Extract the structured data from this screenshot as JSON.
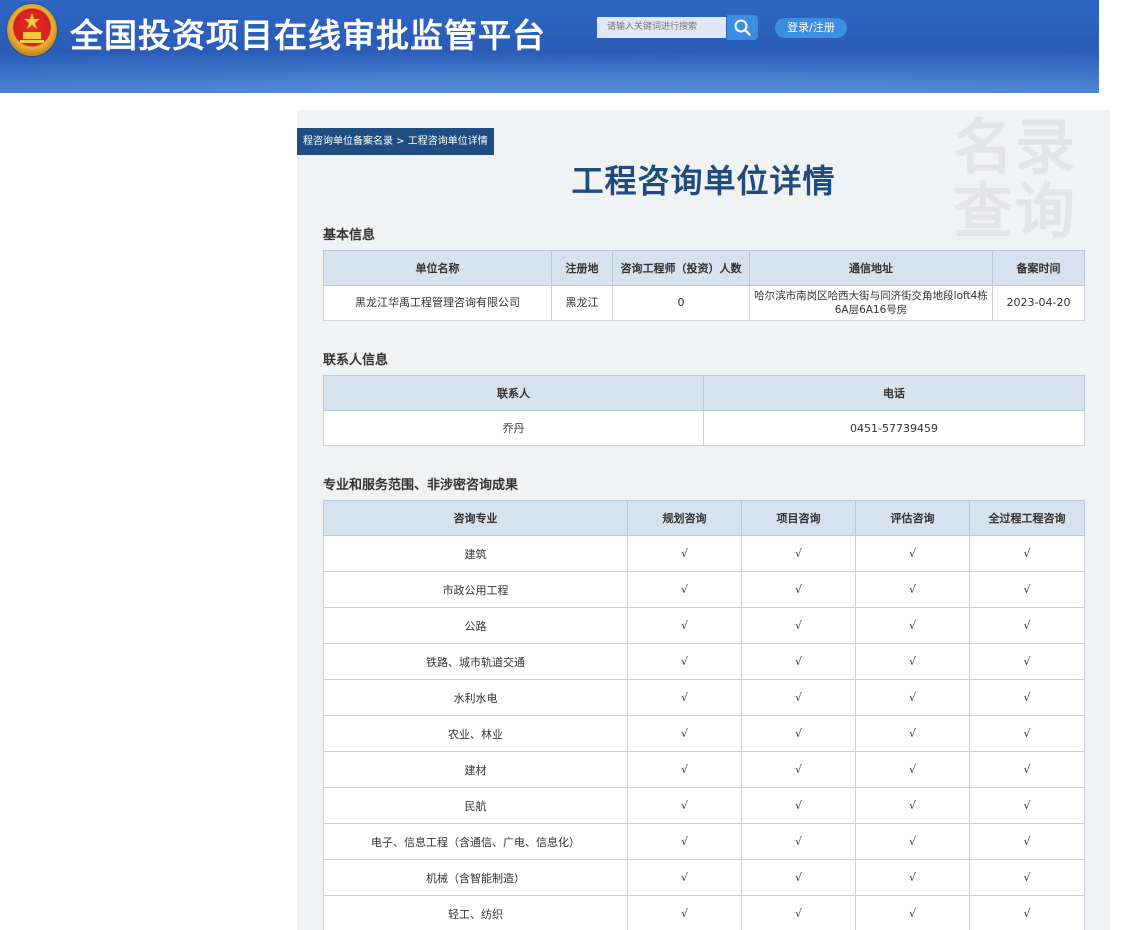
{
  "header": {
    "site_title": "全国投资项目在线审批监管平台",
    "search_placeholder": "请输入关键词进行搜索",
    "login_label": "登录/注册"
  },
  "breadcrumb": "程咨询单位备案名录 > 工程咨询单位详情",
  "watermark": "名录查询",
  "page_title": "工程咨询单位详情",
  "basic": {
    "title": "基本信息",
    "columns": [
      "单位名称",
      "注册地",
      "咨询工程师（投资）人数",
      "通信地址",
      "备案时间"
    ],
    "row": {
      "name": "黑龙江华禹工程管理咨询有限公司",
      "region": "黑龙江",
      "engineers": "0",
      "address": "哈尔滨市南岗区哈西大街与同济街交角地段loft4栋6A层6A16号房",
      "date": "2023-04-20"
    }
  },
  "contact": {
    "title": "联系人信息",
    "columns": [
      "联系人",
      "电话"
    ],
    "row": {
      "person": "乔丹",
      "phone": "0451-57739459"
    }
  },
  "scope": {
    "title": "专业和服务范围、非涉密咨询成果",
    "columns": [
      "咨询专业",
      "规划咨询",
      "项目咨询",
      "评估咨询",
      "全过程工程咨询"
    ],
    "rows": [
      {
        "name": "建筑",
        "marks": [
          "√",
          "√",
          "√",
          "√"
        ]
      },
      {
        "name": "市政公用工程",
        "marks": [
          "√",
          "√",
          "√",
          "√"
        ]
      },
      {
        "name": "公路",
        "marks": [
          "√",
          "√",
          "√",
          "√"
        ]
      },
      {
        "name": "铁路、城市轨道交通",
        "marks": [
          "√",
          "√",
          "√",
          "√"
        ]
      },
      {
        "name": "水利水电",
        "marks": [
          "√",
          "√",
          "√",
          "√"
        ]
      },
      {
        "name": "农业、林业",
        "marks": [
          "√",
          "√",
          "√",
          "√"
        ]
      },
      {
        "name": "建材",
        "marks": [
          "√",
          "√",
          "√",
          "√"
        ]
      },
      {
        "name": "民航",
        "marks": [
          "√",
          "√",
          "√",
          "√"
        ]
      },
      {
        "name": "电子、信息工程（含通信、广电、信息化）",
        "marks": [
          "√",
          "√",
          "√",
          "√"
        ]
      },
      {
        "name": "机械（含智能制造）",
        "marks": [
          "√",
          "√",
          "√",
          "√"
        ]
      },
      {
        "name": "轻工、纺织",
        "marks": [
          "√",
          "√",
          "√",
          "√"
        ]
      }
    ]
  },
  "colors": {
    "header_bg": "#2a5cb7",
    "accent": "#3b8de0",
    "title": "#1e4c7c",
    "table_header": "#d6e2ee"
  }
}
